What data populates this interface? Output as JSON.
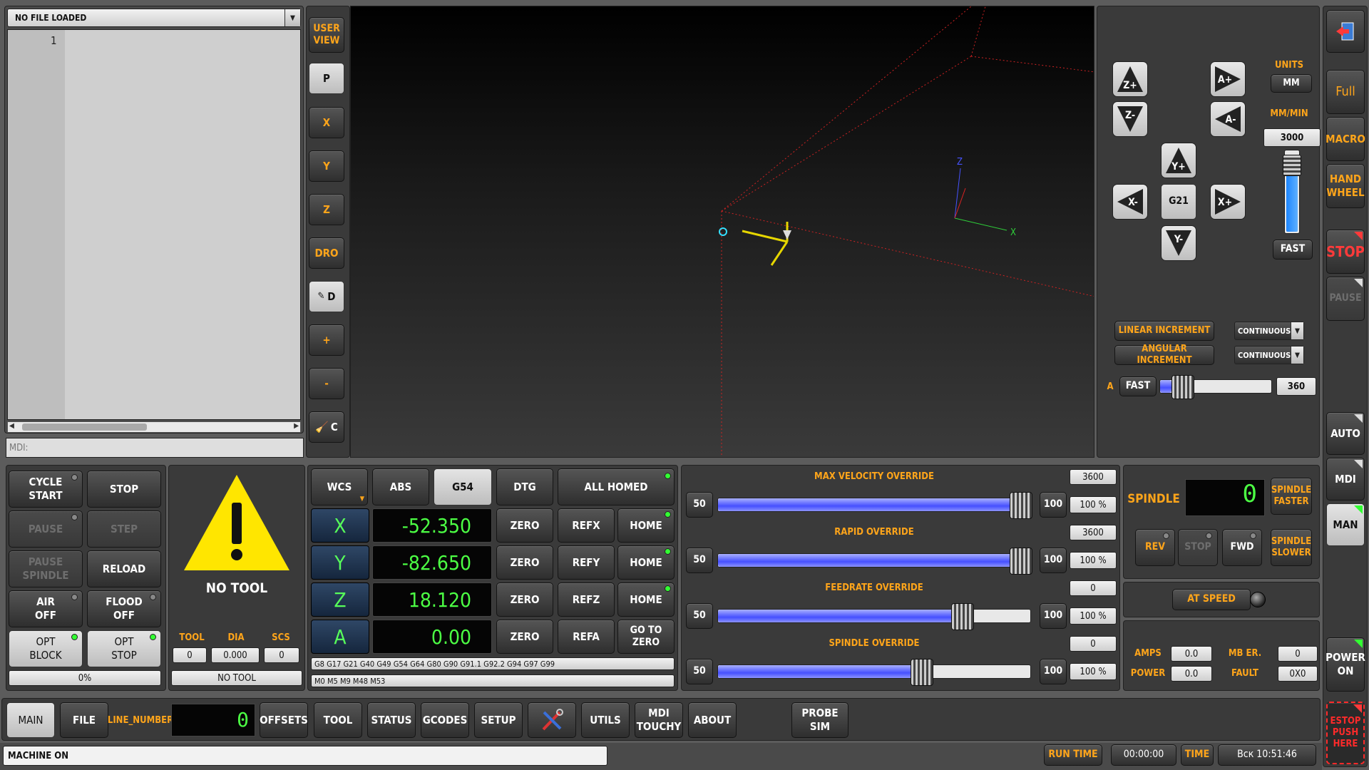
{
  "file_panel": {
    "title": "NO FILE LOADED",
    "line_numbers": [
      "1"
    ],
    "mdi_label": "MDI:"
  },
  "view_buttons": {
    "user_view": "USER\nVIEW",
    "p": "P",
    "x": "X",
    "y": "Y",
    "z": "Z",
    "dro": "DRO",
    "d": "D",
    "plus": "+",
    "minus": "-",
    "c": "C"
  },
  "preview": {
    "axis_z": "Z",
    "axis_x": "X"
  },
  "jog": {
    "z_plus": "Z+",
    "z_minus": "Z-",
    "a_plus": "A+",
    "a_minus": "A-",
    "y_plus": "Y+",
    "y_minus": "Y-",
    "x_minus": "X-",
    "x_plus": "X+",
    "center": "G21",
    "units_label": "UNITS",
    "units_value": "MM",
    "rate_label": "MM/MIN",
    "rate_value": "3000",
    "fast": "FAST",
    "rate_slider_fraction": 0.95,
    "linear_increment_label": "LINEAR INCREMENT",
    "linear_increment_value": "CONTINUOUS",
    "angular_increment_label": "ANGULAR INCREMENT",
    "angular_increment_value": "CONTINUOUS",
    "a_label": "A",
    "a_fast": "FAST",
    "a_value": "360",
    "a_slider_fraction": 0.1
  },
  "right_bar": {
    "full": "Full",
    "macro": "MACRO",
    "handwheel": "HAND\nWHEEL",
    "stop": "STOP",
    "pause": "PAUSE",
    "auto": "AUTO",
    "mdi": "MDI",
    "man": "MAN",
    "power_on": "POWER\nON",
    "estop": "ESTOP\nPUSH\nHERE"
  },
  "controls": {
    "cycle_start": "CYCLE\nSTART",
    "stop": "STOP",
    "pause": "PAUSE",
    "step": "STEP",
    "pause_spindle": "PAUSE\nSPINDLE",
    "reload": "RELOAD",
    "air_off": "AIR\nOFF",
    "flood_off": "FLOOD\nOFF",
    "opt_block": "OPT\nBLOCK",
    "opt_stop": "OPT\nSTOP",
    "progress": "0%"
  },
  "tool": {
    "no_tool_big": "NO TOOL",
    "tool_label": "TOOL",
    "dia_label": "DIA",
    "scs_label": "SCS",
    "tool_value": "0",
    "dia_value": "0.000",
    "scs_value": "0",
    "tool_name": "NO TOOL"
  },
  "dro": {
    "wcs": "WCS",
    "abs": "ABS",
    "g54": "G54",
    "dtg": "DTG",
    "all_homed": "ALL HOMED",
    "axes": [
      {
        "name": "X",
        "value": "-52.350",
        "zero": "ZERO",
        "ref": "REFX",
        "home": "HOME"
      },
      {
        "name": "Y",
        "value": "-82.650",
        "zero": "ZERO",
        "ref": "REFY",
        "home": "HOME"
      },
      {
        "name": "Z",
        "value": "18.120",
        "zero": "ZERO",
        "ref": "REFZ",
        "home": "HOME"
      },
      {
        "name": "A",
        "value": "0.00",
        "zero": "ZERO",
        "ref": "REFA",
        "home": "GO TO\nZERO"
      }
    ],
    "gcodes": "G8 G17 G21 G40 G49 G54 G64 G80 G90 G91.1 G92.2 G94 G97 G99",
    "mcodes": "M0 M5 M9 M48 M53"
  },
  "overrides": [
    {
      "title": "MAX VELOCITY OVERRIDE",
      "left": "50",
      "right": "100",
      "value": "3600",
      "percent": "100 %",
      "fraction": 1.0
    },
    {
      "title": "RAPID OVERRIDE",
      "left": "50",
      "right": "100",
      "value": "3600",
      "percent": "100 %",
      "fraction": 1.0
    },
    {
      "title": "FEEDRATE OVERRIDE",
      "left": "50",
      "right": "100",
      "value": "0",
      "percent": "100 %",
      "fraction": 0.8
    },
    {
      "title": "SPINDLE OVERRIDE",
      "left": "50",
      "right": "100",
      "value": "0",
      "percent": "100 %",
      "fraction": 0.66
    }
  ],
  "spindle": {
    "label": "SPINDLE",
    "rpm": "0",
    "faster": "SPINDLE\nFASTER",
    "slower": "SPINDLE\nSLOWER",
    "rev": "REV",
    "stop": "STOP",
    "fwd": "FWD",
    "at_speed": "AT SPEED",
    "amps_label": "AMPS",
    "amps_value": "0.0",
    "mb_er_label": "MB ER.",
    "mb_er_value": "0",
    "power_label": "POWER",
    "power_value": "0.0",
    "fault_label": "FAULT",
    "fault_value": "0X0"
  },
  "tabs": {
    "main": "MAIN",
    "file": "FILE",
    "line_number_label": "LINE_NUMBER",
    "line_number_value": "0",
    "offsets": "OFFSETS",
    "tool": "TOOL",
    "status": "STATUS",
    "gcodes": "GCODES",
    "setup": "SETUP",
    "utils": "UTILS",
    "mdi_touchy": "MDI\nTOUCHY",
    "about": "ABOUT",
    "probe_sim": "PROBE\nSIM"
  },
  "status_bar": {
    "message": "MACHINE ON",
    "run_time_label": "RUN TIME",
    "run_time_value": "00:00:00",
    "time_label": "TIME",
    "time_value": "Вск 10:51:46"
  }
}
